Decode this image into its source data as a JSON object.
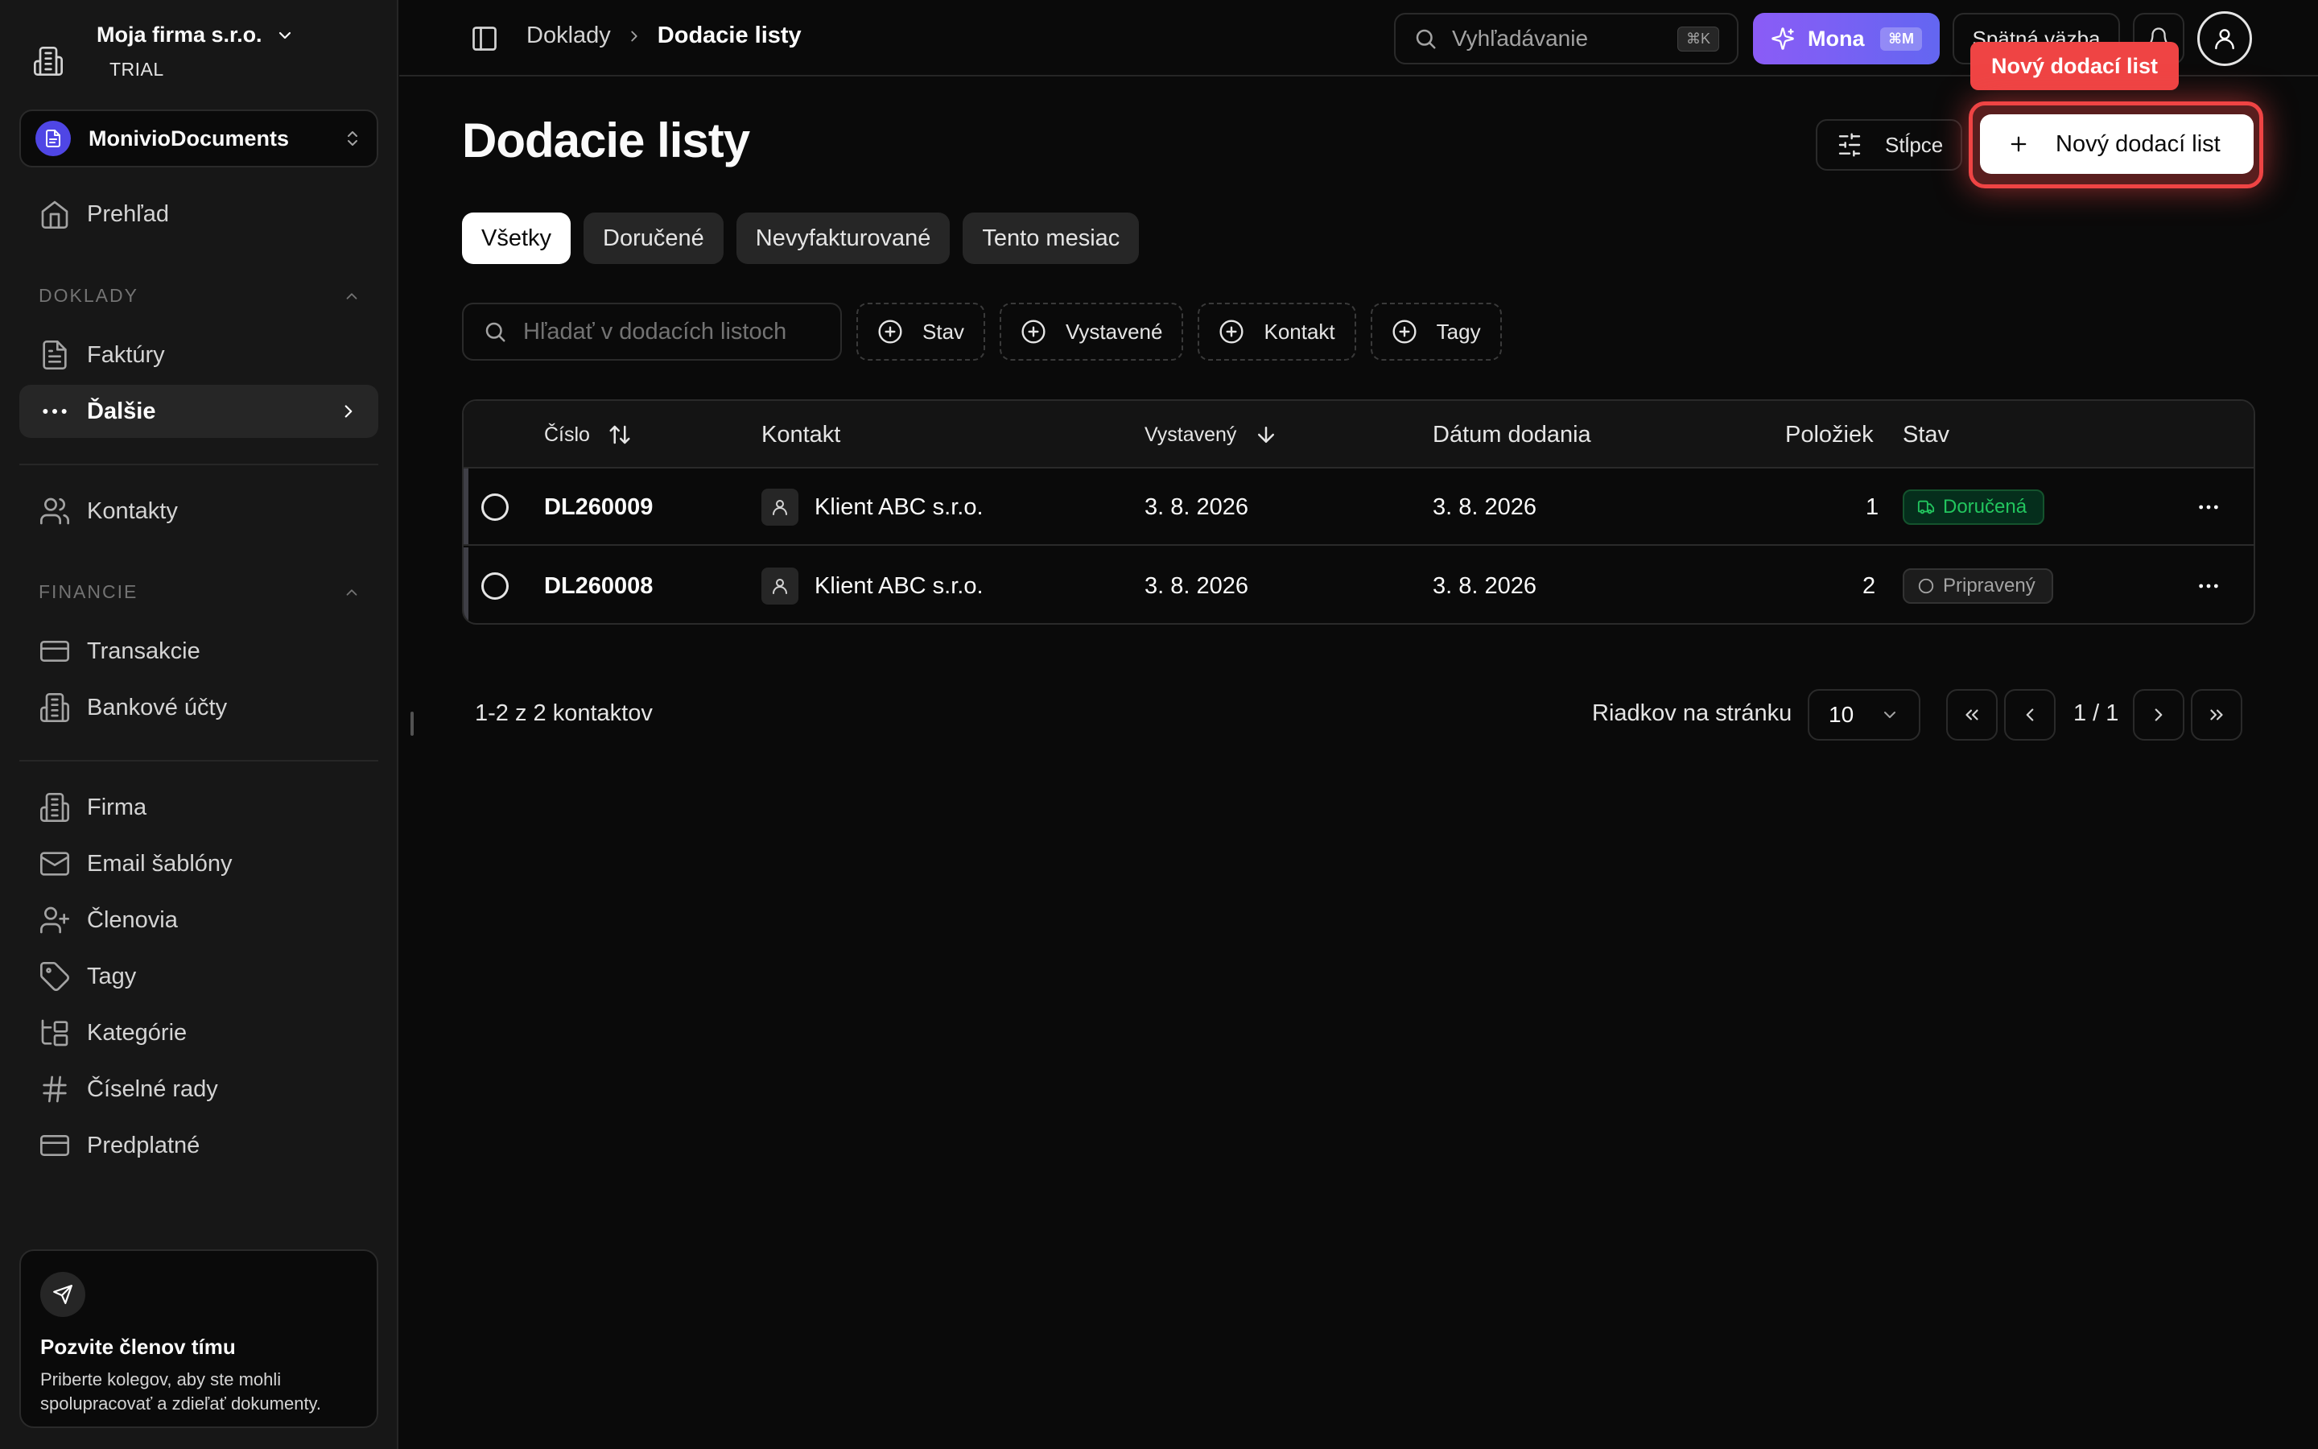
{
  "sidebar": {
    "org_name": "Moja firma s.r.o.",
    "org_plan": "TRIAL",
    "workspace_name": "MonivioDocuments",
    "overview": "Prehľad",
    "section_documents": "DOKLADY",
    "invoices": "Faktúry",
    "more": "Ďalšie",
    "contacts": "Kontakty",
    "section_finance": "FINANCIE",
    "transactions": "Transakcie",
    "bank_accounts": "Bankové účty",
    "company": "Firma",
    "email_templates": "Email šablóny",
    "members": "Členovia",
    "tags": "Tagy",
    "categories": "Kategórie",
    "number_series": "Číselné rady",
    "subscription": "Predplatné",
    "invite_title": "Pozvite členov tímu",
    "invite_desc": "Priberte kolegov, aby ste mohli spolupracovať a zdieľať dokumenty."
  },
  "topbar": {
    "breadcrumb_1": "Doklady",
    "breadcrumb_2": "Dodacie listy",
    "search_placeholder": "Vyhľadávanie",
    "search_shortcut": "⌘K",
    "mona_label": "Mona",
    "mona_shortcut": "⌘M",
    "feedback_label": "Spätná väzba"
  },
  "main": {
    "title": "Dodacie listy",
    "columns_button": "Stĺpce",
    "new_button": "Nový dodací list",
    "tooltip": "Nový dodací list",
    "tabs": [
      "Všetky",
      "Doručené",
      "Nevyfakturované",
      "Tento mesiac"
    ],
    "search_placeholder": "Hľadať v dodacích listoch",
    "filters": [
      "Stav",
      "Vystavené",
      "Kontakt",
      "Tagy"
    ]
  },
  "table": {
    "headers": {
      "number": "Číslo",
      "contact": "Kontakt",
      "issued": "Vystavený",
      "delivery_date": "Dátum dodania",
      "items": "Položiek",
      "status": "Stav"
    },
    "rows": [
      {
        "number": "DL260009",
        "contact": "Klient ABC s.r.o.",
        "issued": "3. 8. 2026",
        "delivery_date": "3. 8. 2026",
        "items": "1",
        "status": "Doručená"
      },
      {
        "number": "DL260008",
        "contact": "Klient ABC s.r.o.",
        "issued": "3. 8. 2026",
        "delivery_date": "3. 8. 2026",
        "items": "2",
        "status": "Pripravený"
      }
    ]
  },
  "pagination": {
    "info": "1-2 z 2 kontaktov",
    "rows_label": "Riadkov na stránku",
    "rows_value": "10",
    "page": "1 / 1"
  },
  "colors": {
    "accent_red": "#ef4444",
    "mona_gradient_start": "#8b5cf6",
    "mona_gradient_end": "#6366f1",
    "delivered_green": "#22c55e",
    "workspace_blue": "#4f46e5"
  }
}
